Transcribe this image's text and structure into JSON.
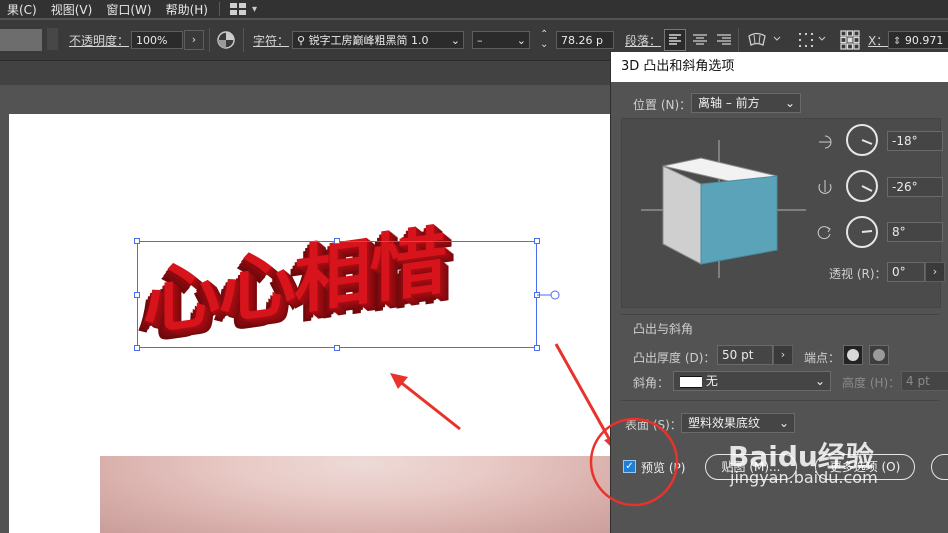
{
  "menubar": {
    "items": [
      "果(C)",
      "视图(V)",
      "窗口(W)",
      "帮助(H)"
    ]
  },
  "control": {
    "opacity_label": "不透明度：",
    "opacity_value": "100%",
    "char_label": "字符：",
    "font_name": "锐字工房巅峰粗黑简 1.0",
    "font_style": "–",
    "font_size": "78.26 p",
    "para_label": "段落：",
    "x_label": "X：",
    "x_value": "90.971"
  },
  "artwork": {
    "text": "心心相惜"
  },
  "dialog": {
    "title": "3D 凸出和斜角选项",
    "position_label": "位置 (N)：",
    "position_value": "离轴 – 前方",
    "rot_x": "-18°",
    "rot_y": "-26°",
    "rot_z": "8°",
    "perspective_label": "透视 (R)：",
    "perspective_value": "0°",
    "extrude_section": "凸出与斜角",
    "depth_label": "凸出厚度 (D)：",
    "depth_value": "50 pt",
    "cap_label": "端点：",
    "bevel_label": "斜角：",
    "bevel_value": "无",
    "height_label": "高度 (H)：",
    "height_value": "4 pt",
    "surface_label": "表面 (S)：",
    "surface_value": "塑料效果底纹",
    "preview_label": "预览 (P)",
    "paste_button": "贴图 (M)...",
    "more_button": "更多选项 (O)"
  },
  "watermark": {
    "brand": "Baidu经验",
    "url": "jingyan.baidu.com"
  },
  "colors": {
    "accent_red": "#d7131b",
    "selection_blue": "#4a6cf0",
    "cube_front": "#5aa3b8",
    "annotation_red": "#e8322b"
  }
}
